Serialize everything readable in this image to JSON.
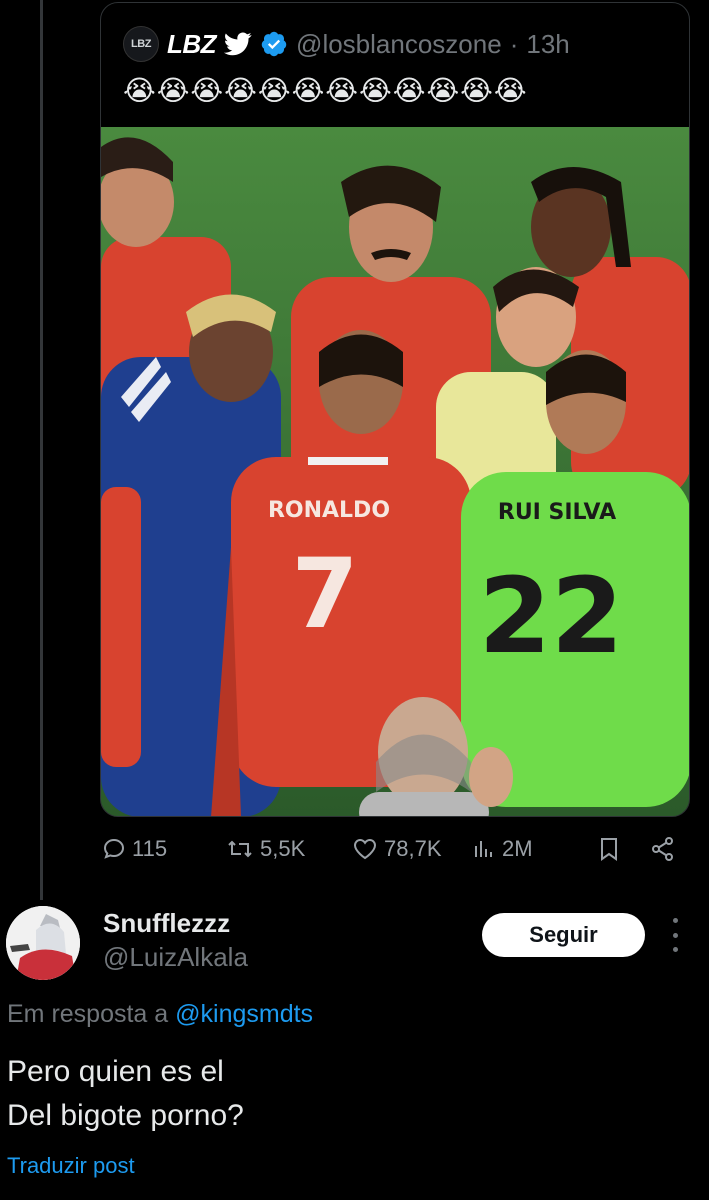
{
  "quoted_post": {
    "avatar_text": "LBZ",
    "display_name": "LBZ",
    "handle": "@losblancoszone",
    "separator": "·",
    "time": "13h",
    "text": "😭😭😭😭😭😭😭😭😭😭😭😭",
    "media": {
      "jersey_names": [
        "RONALDO",
        "RUI SILVA"
      ],
      "jersey_numbers": [
        "7",
        "22"
      ]
    },
    "icons": [
      "bird-icon",
      "verified-icon"
    ]
  },
  "actions": {
    "replies": "115",
    "reposts": "5,5K",
    "likes": "78,7K",
    "views": "2M"
  },
  "reply": {
    "display_name": "Snufflezzz",
    "handle": "@LuizAlkala",
    "follow_label": "Seguir",
    "reply_to_prefix": "Em resposta a",
    "reply_to_mention": "@kingsmdts",
    "text": "Pero quien es el\nDel bigote porno?",
    "translate_label": "Traduzir post"
  },
  "colors": {
    "background": "#000000",
    "accent": "#1d9bf0",
    "muted": "#71767b",
    "verified": "#1d9bf0"
  }
}
